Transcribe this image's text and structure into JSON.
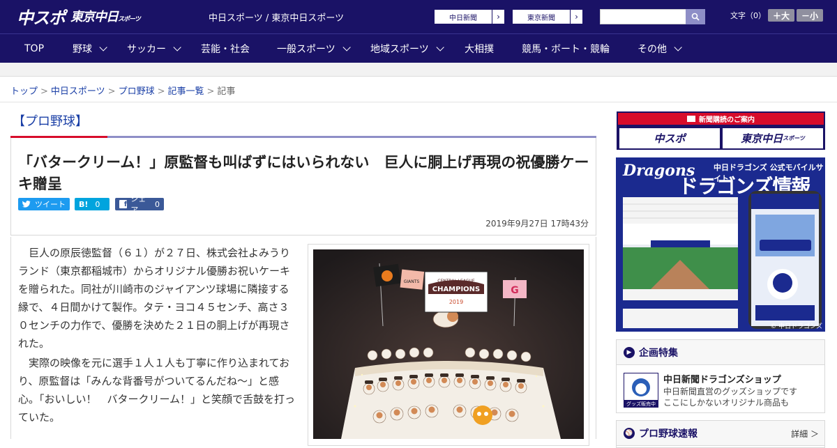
{
  "header": {
    "logo_chuspo": "中スポ",
    "logo_tokyo": "東京中日",
    "logo_tokyo_small": "スポーツ",
    "site_names": "中日スポーツ / 東京中日スポーツ",
    "links": [
      {
        "label": "中日新聞",
        "arrow": "›"
      },
      {
        "label": "東京新聞",
        "arrow": "›"
      }
    ],
    "search_placeholder": "",
    "font_size_label": "文字（0）",
    "font_bigger": "＋大",
    "font_smaller": "－小"
  },
  "nav": {
    "items": [
      {
        "label": "TOP",
        "dropdown": false
      },
      {
        "label": "野球",
        "dropdown": true
      },
      {
        "label": "サッカー",
        "dropdown": true
      },
      {
        "label": "芸能・社会",
        "dropdown": false
      },
      {
        "label": "一般スポーツ",
        "dropdown": true
      },
      {
        "label": "地域スポーツ",
        "dropdown": true
      },
      {
        "label": "大相撲",
        "dropdown": false
      },
      {
        "label": "競馬・ボート・競輪",
        "dropdown": false
      },
      {
        "label": "その他",
        "dropdown": true
      }
    ]
  },
  "breadcrumb": {
    "items": [
      "トップ",
      "中日スポーツ",
      "プロ野球",
      "記事一覧"
    ],
    "current": "記事",
    "separator": ">"
  },
  "article": {
    "category": "【プロ野球】",
    "headline": "「バタークリーム！」原監督も叫ばずにはいられない　巨人に胴上げ再現の祝優勝ケーキ贈呈",
    "share": {
      "tweet": "ツイート",
      "hatena_label": "B!",
      "hatena_count": "0",
      "facebook_label": "シェア",
      "facebook_count": "0"
    },
    "date": "2019年9月27日 17時43分",
    "paragraphs": [
      "巨人の原辰徳監督（６１）が２７日、株式会社よみうりランド（東京都稲城市）からオリジナル優勝お祝いケーキを贈られた。同社が川崎市のジャイアンツ球場に隣接する縁で、４日間かけて製作。タテ・ヨコ４５センチ、高さ３０センチの力作で、優勝を決めた２１日の胴上げが再現された。",
      "実際の映像を元に選手１人１人も丁寧に作り込まれており、原監督は「みんな背番号がついてるんだね～」と感心。「おいしい！　バタークリーム！」と笑顔で舌鼓を打っていた。"
    ],
    "photo": {
      "plaque_top": "CENTRAL LEAGUE",
      "plaque_main": "CHAMPIONS",
      "plaque_year": "2019",
      "flag_giants": "GIANTS",
      "flag_g": "G"
    }
  },
  "sidebar": {
    "subscribe": {
      "title": "新聞購読のご案内",
      "chuspo": "中スポ",
      "tokyo": "東京中日",
      "tokyo_small": "スポーツ"
    },
    "dragons_ad": {
      "title_en": "Dragons",
      "subtitle": "中日ドラゴンズ 公式モバイルサイト",
      "title_jp": "ドラゴンズ情報",
      "copyright": "© 中日ドラゴンズ"
    },
    "kikaku": {
      "title": "企画特集",
      "shop_thumb_label": "グッズ販売中",
      "shop_title": "中日新聞ドラゴンズショップ",
      "shop_desc1": "中日新聞直営のグッズショップです",
      "shop_desc2": "ここにしかないオリジナル商品も"
    },
    "sokuhou": {
      "title": "プロ野球速報",
      "detail": "詳細 ＞"
    }
  },
  "colors": {
    "brand_navy": "#1a1266",
    "accent_red": "#d70c2b",
    "accent_purple": "#8e8ec7",
    "link_blue": "#1a3fa6",
    "twitter": "#1d9bf0",
    "hatena": "#00a4de",
    "facebook": "#3b5998"
  }
}
